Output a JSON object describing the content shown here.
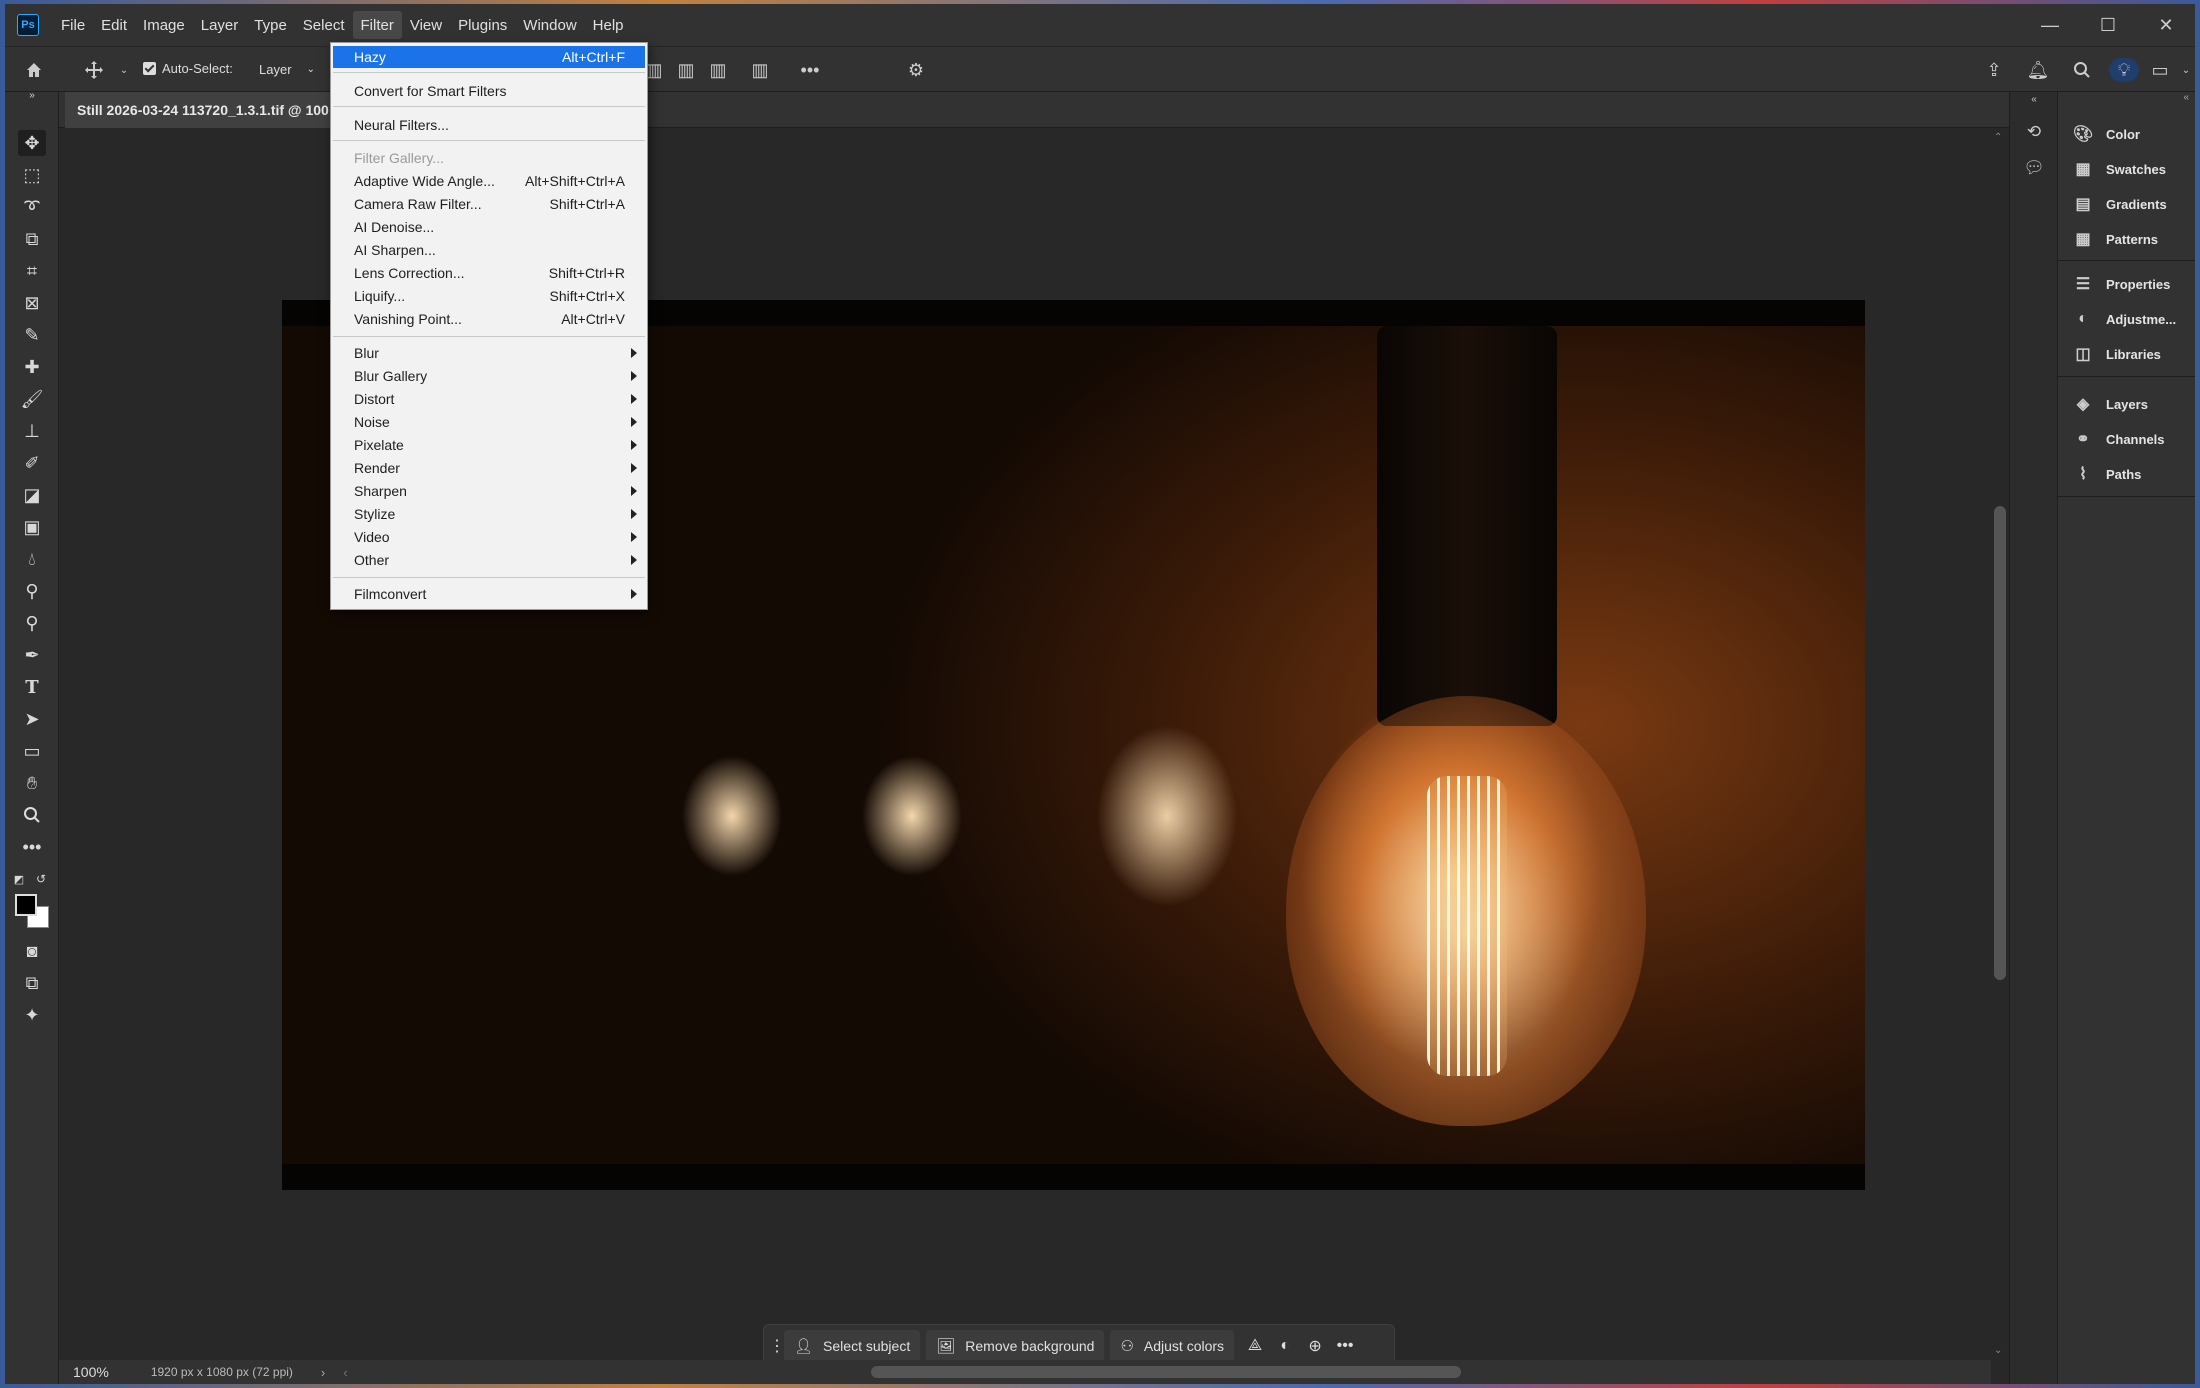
{
  "app": {
    "logo": "Ps"
  },
  "menubar": {
    "items": [
      "File",
      "Edit",
      "Image",
      "Layer",
      "Type",
      "Select",
      "Filter",
      "View",
      "Plugins",
      "Window",
      "Help"
    ],
    "active": "Filter"
  },
  "window_controls": {
    "minimize": "—",
    "maximize": "☐",
    "close": "✕"
  },
  "options_bar": {
    "auto_select_label": "Auto-Select:",
    "auto_select_checked": true,
    "target_value": "Layer"
  },
  "document": {
    "tab_title": "Still 2026-03-24 113720_1.3.1.tif @ 100",
    "zoom": "100%",
    "info": "1920 px x 1080 px (72 ppi)"
  },
  "filter_menu": {
    "items": [
      {
        "label": "Hazy",
        "shortcut": "Alt+Ctrl+F",
        "highlighted": true
      },
      {
        "label": "Convert for Smart Filters"
      },
      {
        "label": "Neural Filters..."
      },
      {
        "label": "Filter Gallery...",
        "disabled": true
      },
      {
        "label": "Adaptive Wide Angle...",
        "shortcut": "Alt+Shift+Ctrl+A"
      },
      {
        "label": "Camera Raw Filter...",
        "shortcut": "Shift+Ctrl+A"
      },
      {
        "label": "AI Denoise..."
      },
      {
        "label": "AI Sharpen..."
      },
      {
        "label": "Lens Correction...",
        "shortcut": "Shift+Ctrl+R"
      },
      {
        "label": "Liquify...",
        "shortcut": "Shift+Ctrl+X"
      },
      {
        "label": "Vanishing Point...",
        "shortcut": "Alt+Ctrl+V"
      },
      {
        "label": "Blur",
        "submenu": true
      },
      {
        "label": "Blur Gallery",
        "submenu": true
      },
      {
        "label": "Distort",
        "submenu": true
      },
      {
        "label": "Noise",
        "submenu": true
      },
      {
        "label": "Pixelate",
        "submenu": true
      },
      {
        "label": "Render",
        "submenu": true
      },
      {
        "label": "Sharpen",
        "submenu": true
      },
      {
        "label": "Stylize",
        "submenu": true
      },
      {
        "label": "Video",
        "submenu": true
      },
      {
        "label": "Other",
        "submenu": true
      },
      {
        "label": "Filmconvert",
        "submenu": true
      }
    ]
  },
  "contextual_taskbar": {
    "select_subject": "Select subject",
    "remove_background": "Remove background",
    "adjust_colors": "Adjust colors"
  },
  "right_panels": {
    "group1": [
      "Color",
      "Swatches",
      "Gradients",
      "Patterns"
    ],
    "group2": [
      "Properties",
      "Adjustme...",
      "Libraries"
    ],
    "group3": [
      "Layers",
      "Channels",
      "Paths"
    ]
  },
  "colors": {
    "menu_highlight": "#1a73e8",
    "foreground": "#000000",
    "background": "#ffffff"
  }
}
